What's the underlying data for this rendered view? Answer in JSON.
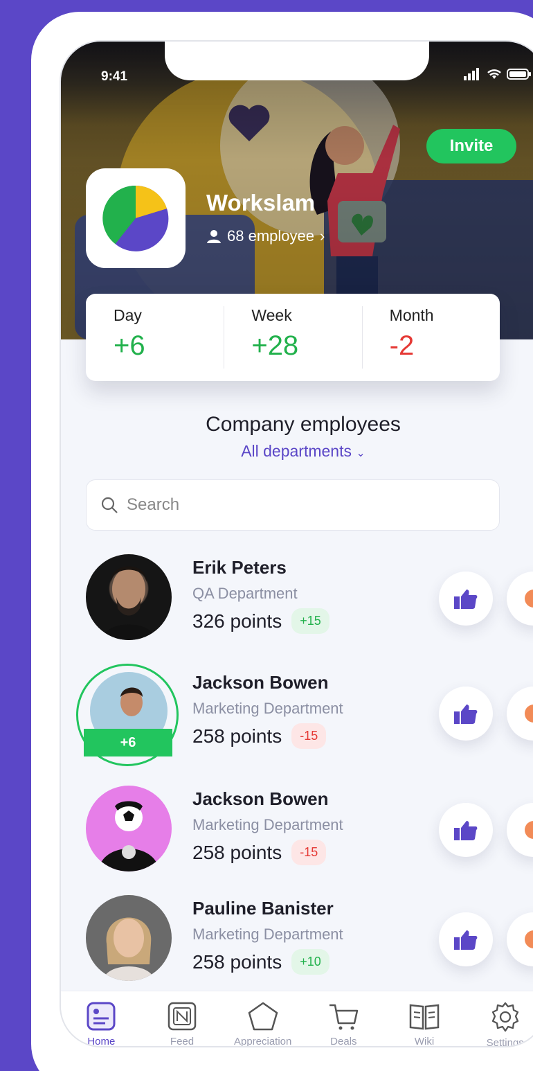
{
  "status": {
    "time": "9:41"
  },
  "header": {
    "invite_label": "Invite",
    "company_name": "Workslam",
    "employee_count": "68 employee"
  },
  "stats": [
    {
      "label": "Day",
      "value": "+6",
      "tone": "pos"
    },
    {
      "label": "Week",
      "value": "+28",
      "tone": "pos"
    },
    {
      "label": "Month",
      "value": "-2",
      "tone": "neg"
    }
  ],
  "section": {
    "title": "Company employees",
    "department_filter": "All departments"
  },
  "search": {
    "placeholder": "Search"
  },
  "employees": [
    {
      "name": "Erik Peters",
      "department": "QA Department",
      "points": "326 points",
      "delta": "+15",
      "tone": "pos"
    },
    {
      "name": "Jackson Bowen",
      "department": "Marketing Department",
      "points": "258 points",
      "delta": "-15",
      "tone": "neg",
      "highlight": "+6"
    },
    {
      "name": "Jackson Bowen",
      "department": "Marketing Department",
      "points": "258 points",
      "delta": "-15",
      "tone": "neg"
    },
    {
      "name": "Pauline Banister",
      "department": "Marketing Department",
      "points": "258 points",
      "delta": "+10",
      "tone": "pos"
    }
  ],
  "tabs": [
    {
      "label": "Home",
      "icon": "home-icon",
      "active": true
    },
    {
      "label": "Feed",
      "icon": "feed-icon"
    },
    {
      "label": "Appreciation",
      "icon": "appreciation-icon"
    },
    {
      "label": "Deals",
      "icon": "cart-icon"
    },
    {
      "label": "Wiki",
      "icon": "book-icon"
    },
    {
      "label": "Settings",
      "icon": "gear-icon"
    }
  ],
  "colors": {
    "brand": "#5b47c7",
    "positive": "#22b14c",
    "negative": "#e53935",
    "invite": "#22c55e"
  }
}
